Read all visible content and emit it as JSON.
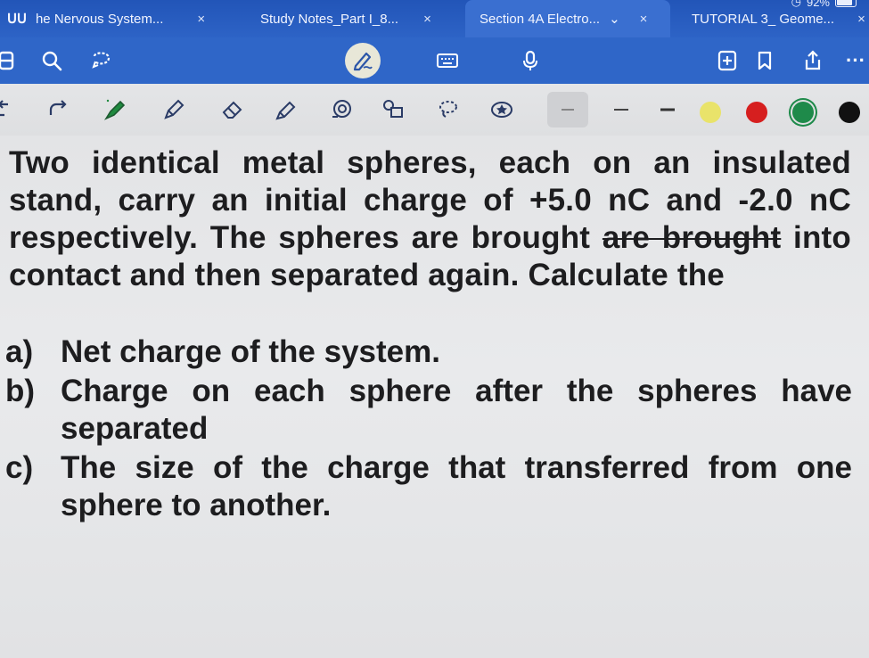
{
  "tabs": [
    {
      "label": "he Nervous System...",
      "close": "×"
    },
    {
      "label": "Study Notes_Part I_8...",
      "close": "×"
    },
    {
      "label": "Section 4A Electro...",
      "chevron": "⌄",
      "close": "×"
    },
    {
      "label": "TUTORIAL 3_ Geome...",
      "close": "×"
    }
  ],
  "status": {
    "battery": "92%"
  },
  "toolbar": {
    "left_icons": [
      "notebook-icon",
      "search-icon",
      "lasso-icon"
    ],
    "center_icons": [
      "pen-mode-icon",
      "keyboard-icon",
      "microphone-icon"
    ],
    "right_icons": [
      "add-page-icon",
      "bookmark-icon",
      "share-icon",
      "more-icon"
    ],
    "more_label": "···"
  },
  "penbar": {
    "tools": [
      "undo",
      "redo",
      "pen",
      "pencil",
      "eraser",
      "highlighter",
      "shape",
      "image",
      "lasso",
      "favorite"
    ],
    "line_widths": [
      "thin",
      "medium",
      "thick"
    ],
    "colors": [
      "#e9e36a",
      "#d61f1f",
      "#1e8a4a",
      "#111111"
    ]
  },
  "document": {
    "paragraph": {
      "before_strike": "Two identical metal spheres, each on an insulated stand, carry an initial charge of +5.0 nC and -2.0 nC respectively. The spheres are brought ",
      "struck": "are brought",
      "after_strike": " into contact and then separated again. Calculate the"
    },
    "questions": [
      {
        "label": "a)",
        "text": "Net charge of the system."
      },
      {
        "label": "b)",
        "text": "Charge on each sphere after the spheres have separated"
      },
      {
        "label": "c)",
        "text": "The size of the charge that transferred from one sphere to another."
      }
    ]
  }
}
